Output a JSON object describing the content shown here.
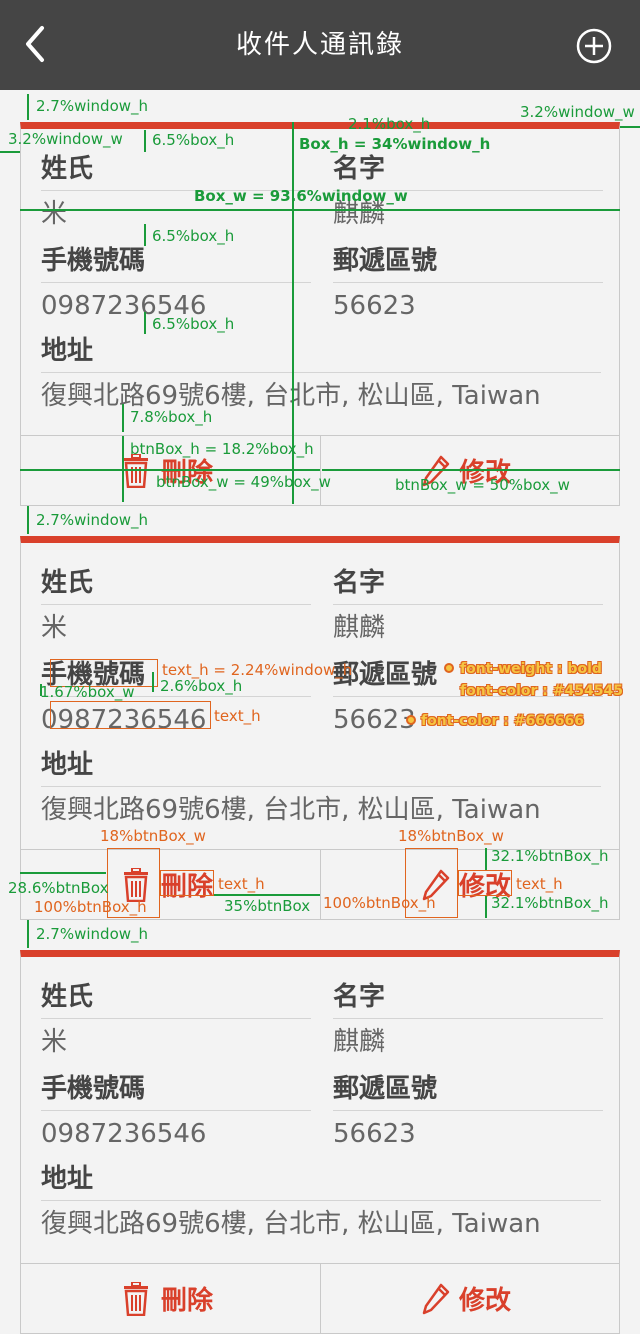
{
  "header": {
    "title": "收件人通訊錄"
  },
  "labels": {
    "surname": "姓氏",
    "given_name": "名字",
    "mobile": "手機號碼",
    "postal_code": "郵遞區號",
    "address": "地址"
  },
  "buttons": {
    "delete": "刪除",
    "edit": "修改"
  },
  "contacts": [
    {
      "surname": "米",
      "given_name": "麒麟",
      "mobile": "0987236546",
      "postal_code": "56623",
      "address": "復興北路69號6樓, 台北市, 松山區, Taiwan"
    },
    {
      "surname": "米",
      "given_name": "麒麟",
      "mobile": "0987236546",
      "postal_code": "56623",
      "address": "復興北路69號6樓, 台北市, 松山區, Taiwan"
    },
    {
      "surname": "米",
      "given_name": "麒麟",
      "mobile": "0987236546",
      "postal_code": "56623",
      "address": "復興北路69號6樓, 台北市, 松山區, Taiwan"
    }
  ],
  "annotations": {
    "margin_top": "2.7%window_h",
    "margin_side_left": "3.2%window_w",
    "margin_side_right": "3.2%window_w",
    "top_border": "2.1%box_h",
    "box_h": "Box_h = 34%window_h",
    "box_w": "Box_w = 93.6%window_w",
    "gap_a": "6.5%box_h",
    "gap_b": "6.5%box_h",
    "gap_c": "6.5%box_h",
    "gap_d": "7.8%box_h",
    "btnbox_h": "btnBox_h = 18.2%box_h",
    "btnbox_w_left": "btnBox_w = 49%box_w",
    "btnbox_w_right": "btnBox_w = 50%box_w",
    "margin_between_1": "2.7%window_h",
    "margin_between_2": "2.7%window_h",
    "text_h": "text_h = 2.24%window_h",
    "pad_left": "1.67%box_w",
    "row_gap": "2.6%box_h",
    "text_h_short": "text_h",
    "font_weight": "font-weight : bold",
    "font_color_label": "font-color : #454545",
    "font_color_value": "font-color : #666666",
    "icon_w_left": "18%btnBox_w",
    "icon_w_right": "18%btnBox_w",
    "icon_margin_left": "28.6%btnBox",
    "icon_h_left": "100%btnBox_h",
    "icon_h_right": "100%btnBox_h",
    "btn_text_left": "text_h",
    "btn_text_right": "text_h",
    "btn_gap": "35%btnBox",
    "btn_pad_top": "32.1%btnBox_h",
    "btn_pad_bottom": "32.1%btnBox_h"
  }
}
